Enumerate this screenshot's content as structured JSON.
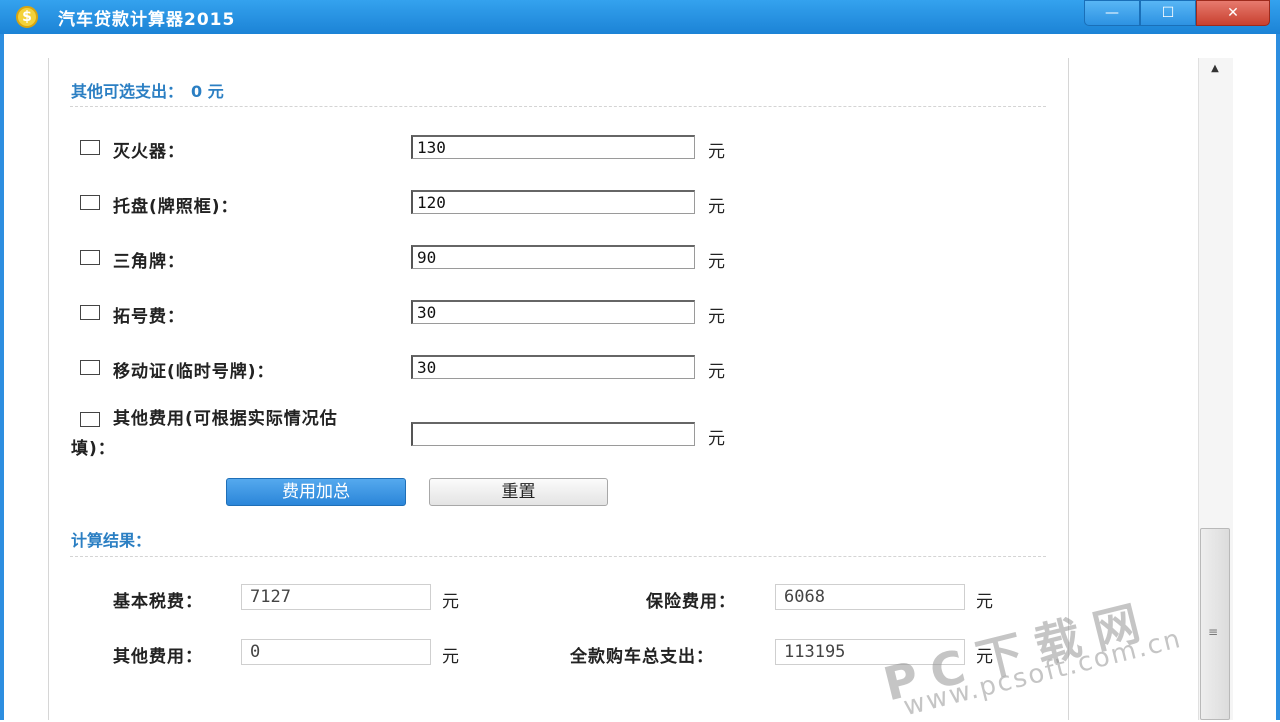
{
  "window": {
    "title": "汽车贷款计算器2015",
    "icon": "dollar-coin-icon",
    "controls": {
      "minimize": "—",
      "maximize": "☐",
      "close": "✕"
    }
  },
  "optional": {
    "heading": "其他可选支出：",
    "amount": "0 元",
    "items": [
      {
        "label": "灭火器：",
        "value": "130",
        "unit": "元",
        "checked": false
      },
      {
        "label": "托盘(牌照框)：",
        "value": "120",
        "unit": "元",
        "checked": false
      },
      {
        "label": "三角牌：",
        "value": "90",
        "unit": "元",
        "checked": false
      },
      {
        "label": "拓号费：",
        "value": "30",
        "unit": "元",
        "checked": false
      },
      {
        "label": "移动证(临时号牌)：",
        "value": "30",
        "unit": "元",
        "checked": false
      },
      {
        "label": "其他费用(可根据实际情况估填)：",
        "value": "",
        "unit": "元",
        "checked": false
      }
    ],
    "sum_button": "费用加总",
    "reset_button": "重置"
  },
  "result": {
    "heading": "计算结果：",
    "basic_tax": {
      "label": "基本税费：",
      "value": "7127",
      "unit": "元"
    },
    "insurance": {
      "label": "保险费用：",
      "value": "6068",
      "unit": "元"
    },
    "other": {
      "label": "其他费用：",
      "value": "0",
      "unit": "元"
    },
    "total": {
      "label": "全款购车总支出：",
      "value": "113195",
      "unit": "元"
    }
  },
  "watermark": {
    "line1": "PC下载网",
    "line2": "www.pcsoft.com.cn"
  },
  "colors": {
    "titlebar": "#2d8ee0",
    "accent": "#2b7fc3"
  }
}
